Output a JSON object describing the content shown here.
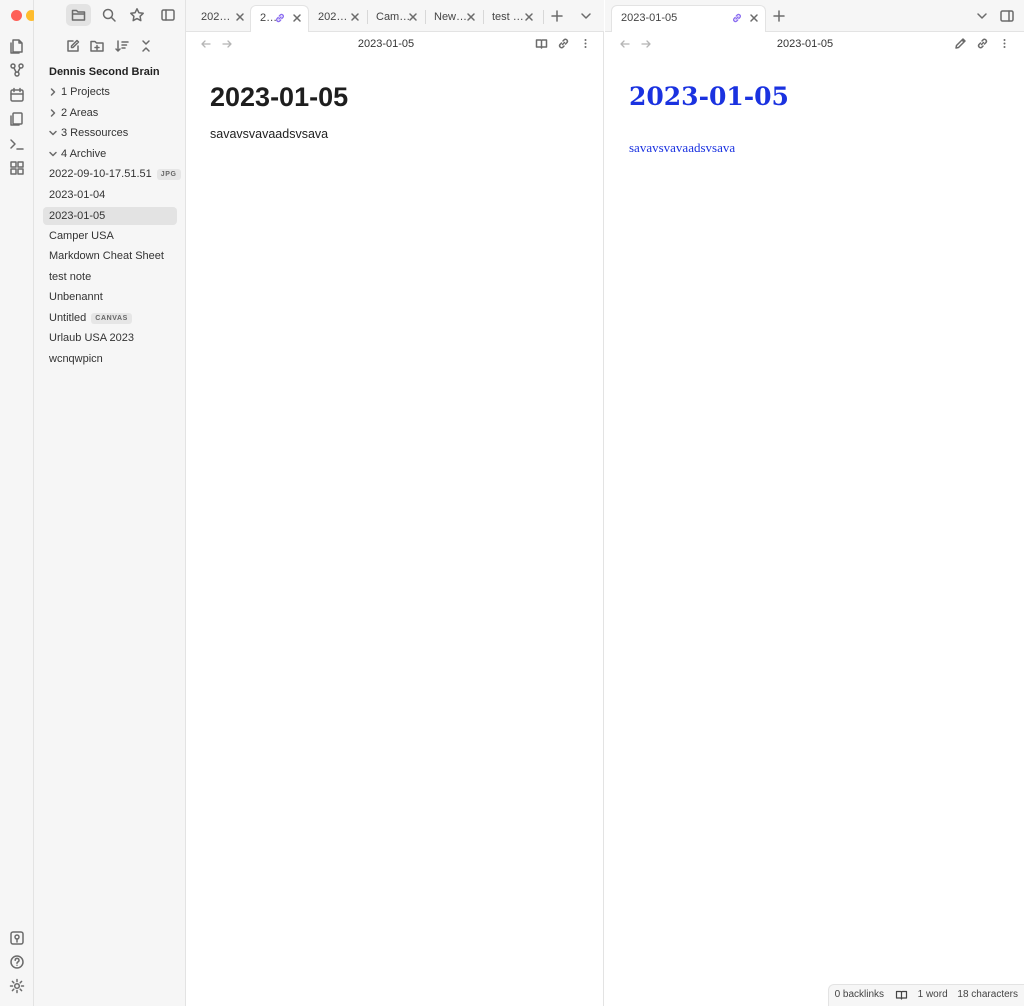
{
  "ribbon": {
    "traffic_lights": {
      "close": "#fe5f57",
      "minimize": "#febc2e",
      "maximize": "#28c840"
    },
    "top_icons": [
      "file-explorer-icon",
      "search-icon",
      "bookmark-star-icon"
    ],
    "left_icons": [
      "quick-switcher-icon",
      "graph-view-icon",
      "daily-note-icon",
      "templates-icon",
      "command-palette-icon",
      "canvas-icon"
    ],
    "bottom_icons": [
      "vault-switcher-icon",
      "help-icon",
      "settings-icon"
    ]
  },
  "sidebar": {
    "toolbar": [
      "new-note-icon",
      "new-folder-icon",
      "sort-icon",
      "collapse-all-icon"
    ],
    "vault_name": "Dennis Second Brain",
    "folders": [
      {
        "label": "1 Projects",
        "expanded": false
      },
      {
        "label": "2 Areas",
        "expanded": false
      },
      {
        "label": "3 Ressources",
        "expanded": true
      },
      {
        "label": "4 Archive",
        "expanded": true
      }
    ],
    "files": [
      {
        "label": "2022-09-10-17.51.51",
        "badge": "JPG"
      },
      {
        "label": "2023-01-04"
      },
      {
        "label": "2023-01-05",
        "active": true
      },
      {
        "label": "Camper USA"
      },
      {
        "label": "Markdown Cheat Sheet"
      },
      {
        "label": "test note"
      },
      {
        "label": "Unbenannt"
      },
      {
        "label": "Untitled",
        "badge": "CANVAS"
      },
      {
        "label": "Urlaub USA 2023"
      },
      {
        "label": "wcnqwpicn"
      }
    ]
  },
  "left_pane": {
    "tabs": [
      {
        "label": "202…"
      },
      {
        "label": "2…",
        "active": true,
        "linked": true
      },
      {
        "label": "202…"
      },
      {
        "label": "Cam…"
      },
      {
        "label": "New…"
      },
      {
        "label": "test …"
      }
    ],
    "view_title": "2023-01-05",
    "heading": "2023-01-05",
    "body": "savavsvavaadsvsava"
  },
  "right_pane": {
    "tabs": [
      {
        "label": "2023-01-05",
        "active": true,
        "linked": true
      }
    ],
    "view_title": "2023-01-05",
    "heading": "2023-01-05",
    "body": "savavsvavaadsvsava",
    "accent_color": "#1a32e0"
  },
  "status_bar": {
    "backlinks": "0 backlinks",
    "words": "1 word",
    "characters": "18 characters"
  }
}
